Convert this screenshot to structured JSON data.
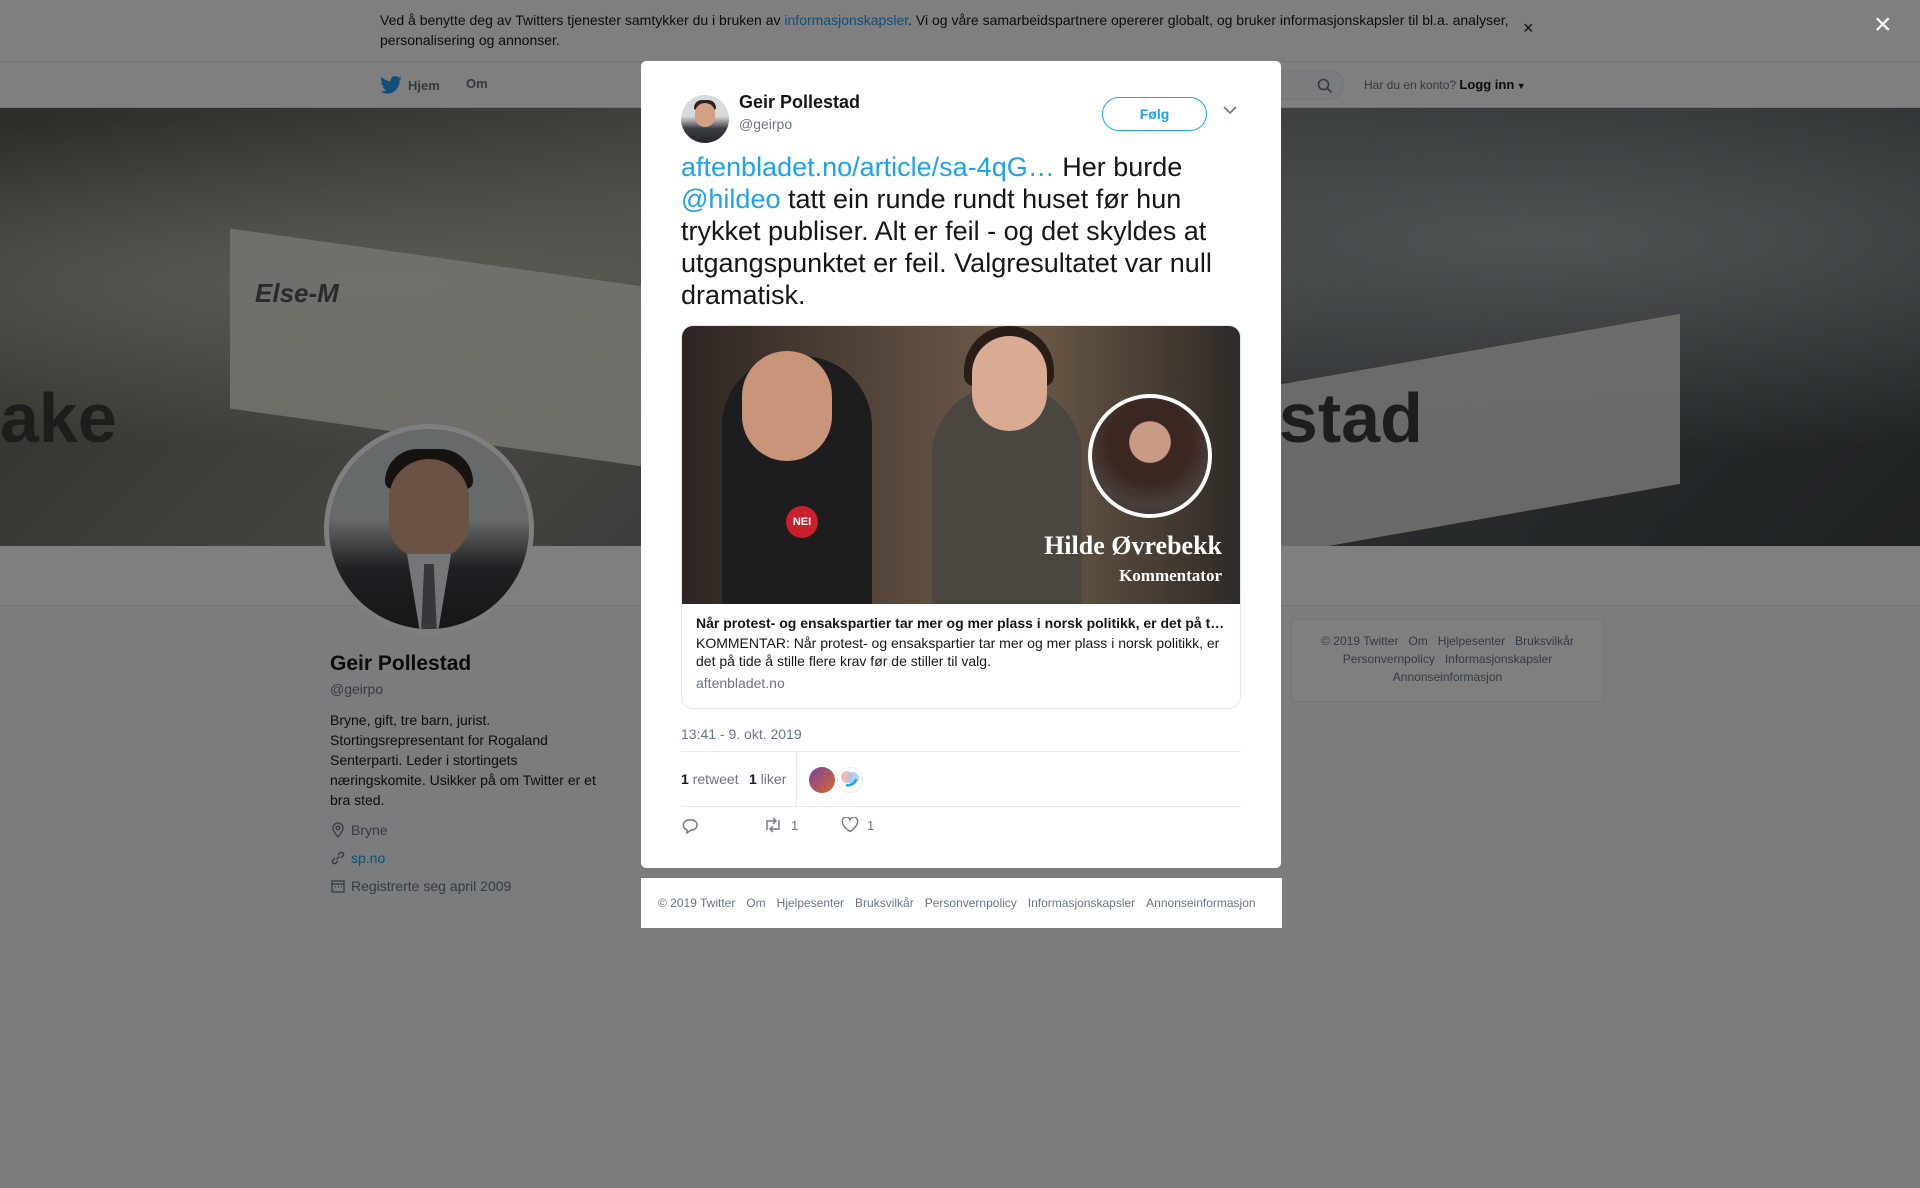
{
  "cookie": {
    "text_before": "Ved å benytte deg av Twitters tjenester samtykker du i bruken av ",
    "link": "informasjonskapsler",
    "text_after": ". Vi og våre samarbeidspartnere opererer globalt, og bruker informasjonskapsler til bl.a. analyser, personalisering og annonser.",
    "close": "×"
  },
  "nav": {
    "home": "Hjem",
    "about": "Om",
    "account_prompt": "Har du en konto?",
    "login": "Logg inn"
  },
  "banner": {
    "word_left": "ake",
    "word_right": "estad",
    "card_text": "Else-M"
  },
  "profile": {
    "name": "Geir Pollestad",
    "handle": "@geirpo",
    "bio": "Bryne, gift, tre barn, jurist. Stortingsrepresentant for Rogaland Senterparti. Leder i stortingets næringskomite. Usikker på om Twitter er et bra sted.",
    "location": "Bryne",
    "url": "sp.no",
    "joined": "Registrerte seg april 2009"
  },
  "side_footer": {
    "items": [
      "© 2019 Twitter",
      "Om",
      "Hjelpesenter",
      "Bruksvilkår",
      "Personvernpolicy",
      "Informasjonskapsler",
      "Annonseinformasjon"
    ]
  },
  "modal": {
    "close": "×",
    "author_name": "Geir Pollestad",
    "author_handle": "@geirpo",
    "follow": "Følg",
    "tweet_link": "aftenbladet.no/article/sa-4qG…",
    "tweet_text_1": " Her burde ",
    "tweet_mention": "@hildeo",
    "tweet_text_2": " tatt ein runde rundt huset før hun trykket publiser. Alt er feil - og det skyldes at utgangspunktet er feil. Valgresultatet var null dramatisk.",
    "card": {
      "overlay_name": "Hilde Øvrebekk",
      "overlay_role": "Kommentator",
      "badge": "NEI",
      "title": "Når protest- og ensakspartier tar mer og mer plass i norsk politikk, er det på tide å stille flere krav før de stiller til valg.",
      "description": "KOMMENTAR: Når protest- og ensakspartier tar mer og mer plass i norsk politikk, er det på tide å stille flere krav før de stiller til valg.",
      "domain": "aftenbladet.no"
    },
    "timestamp": "13:41 - 9. okt. 2019",
    "retweets_count": "1",
    "retweets_label": "retweet",
    "likes_count": "1",
    "likes_label": "liker",
    "action_retweet_count": "1",
    "action_like_count": "1"
  },
  "modal_footer": {
    "items": [
      "© 2019 Twitter",
      "Om",
      "Hjelpesenter",
      "Bruksvilkår",
      "Personvernpolicy",
      "Informasjonskapsler",
      "Annonseinformasjon"
    ]
  },
  "colors": {
    "accent": "#1da1f2",
    "text": "#14171a",
    "muted": "#657786"
  }
}
